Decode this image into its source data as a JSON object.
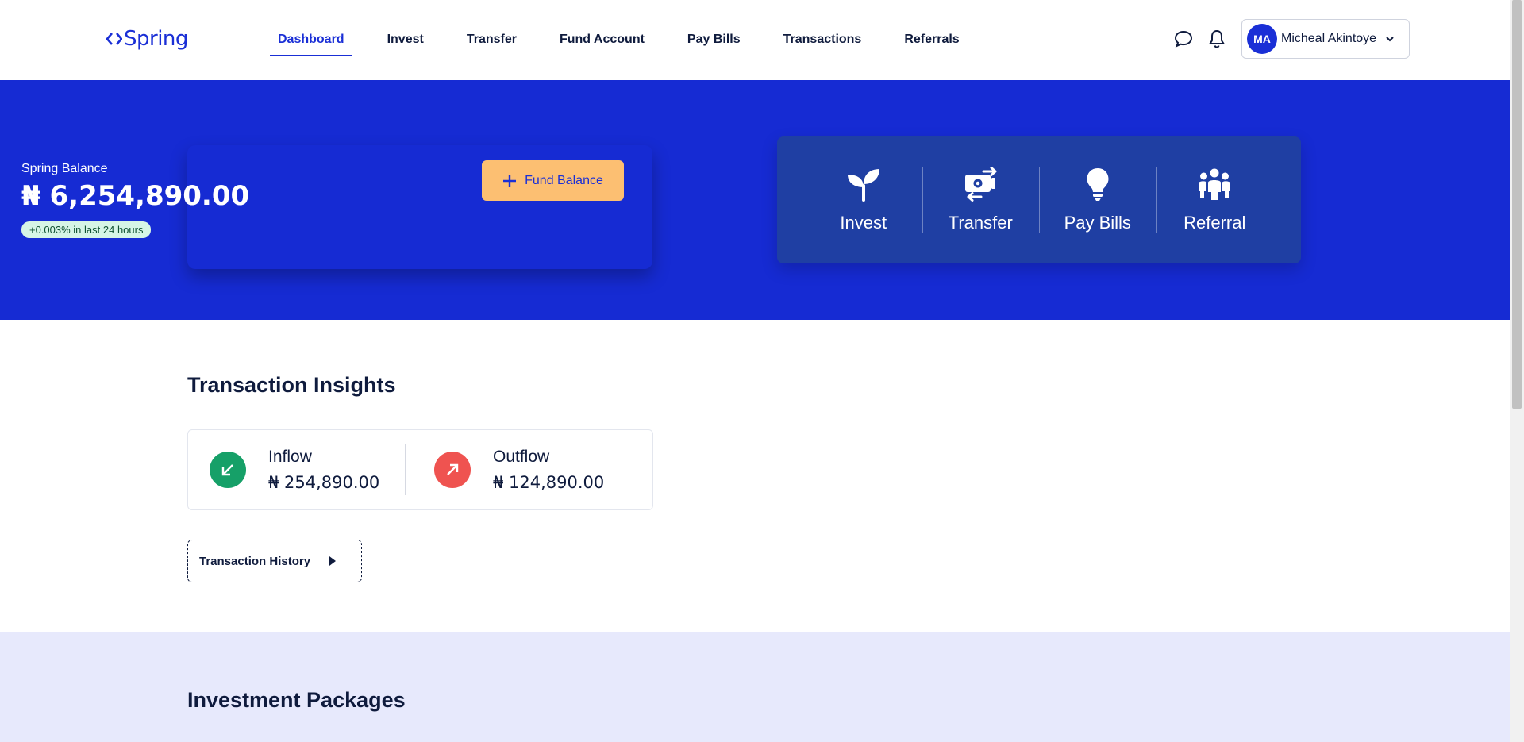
{
  "header": {
    "logo_text": "Spring",
    "nav": [
      {
        "label": "Dashboard",
        "active": true
      },
      {
        "label": "Invest"
      },
      {
        "label": "Transfer"
      },
      {
        "label": "Fund Account"
      },
      {
        "label": "Pay Bills"
      },
      {
        "label": "Transactions"
      },
      {
        "label": "Referrals"
      }
    ],
    "user": {
      "initials": "MA",
      "name": "Micheal Akintoye"
    }
  },
  "balance": {
    "label": "Spring Balance",
    "amount": "₦ 6,254,890.00",
    "change": "+0.003% in last 24 hours",
    "fund_button": "Fund Balance"
  },
  "quick_actions": [
    {
      "label": "Invest",
      "icon": "sprout-icon"
    },
    {
      "label": "Transfer",
      "icon": "money-transfer-icon"
    },
    {
      "label": "Pay Bills",
      "icon": "lightbulb-icon"
    },
    {
      "label": "Referral",
      "icon": "people-group-icon"
    }
  ],
  "insights": {
    "title": "Transaction Insights",
    "inflow": {
      "label": "Inflow",
      "amount": "₦ 254,890.00",
      "color": "#16a068"
    },
    "outflow": {
      "label": "Outflow",
      "amount": "₦ 124,890.00",
      "color": "#ef5350"
    },
    "history_button": "Transaction History"
  },
  "packages": {
    "title": "Investment Packages"
  },
  "colors": {
    "brand": "#162bd3",
    "accent": "#fcbf72",
    "panel": "#1f3fa3",
    "packages_bg": "#e7e9fc"
  }
}
